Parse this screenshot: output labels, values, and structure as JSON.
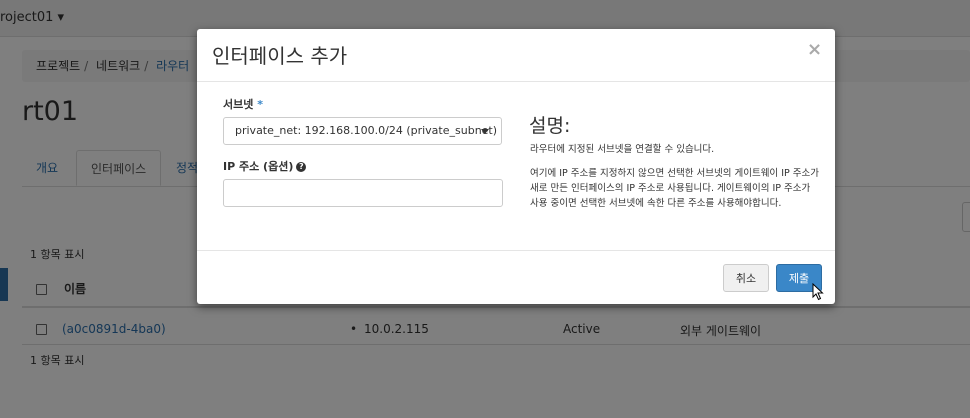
{
  "topbar": {
    "project": "roject01 ▾"
  },
  "breadcrumb": {
    "item1": "프로젝트",
    "item2": "네트워크",
    "item3": "라우터"
  },
  "page": {
    "title": "rt01",
    "tabs": [
      "개요",
      "인터페이스",
      "정적"
    ],
    "count_top": "1 항목 표시",
    "count_bottom": "1 항목 표시",
    "col_name": "이름"
  },
  "table_row": {
    "name": "(a0c0891d-4ba0)",
    "ip": "10.0.2.115",
    "status": "Active",
    "type": "외부 게이트웨이"
  },
  "modal": {
    "title": "인터페이스 추가",
    "close": "×",
    "subnet_label": "서브넷",
    "subnet_required": "*",
    "subnet_value": "private_net: 192.168.100.0/24 (private_subnet)",
    "ip_label": "IP 주소 (옵션)",
    "ip_help": "?",
    "ip_value": "",
    "desc_title": "설명:",
    "desc_p1": "라우터에 지정된 서브넷을 연결할 수 있습니다.",
    "desc_p2": "여기에 IP 주소를 지정하지 않으면 선택한 서브넷의 게이트웨이 IP 주소가 새로 만든 인터페이스의 IP 주소로 사용됩니다. 게이트웨이의 IP 주소가 사용 중이면 선택한 서브넷에 속한 다른 주소를 사용해야합니다.",
    "cancel_label": "취소",
    "submit_label": "제출"
  }
}
